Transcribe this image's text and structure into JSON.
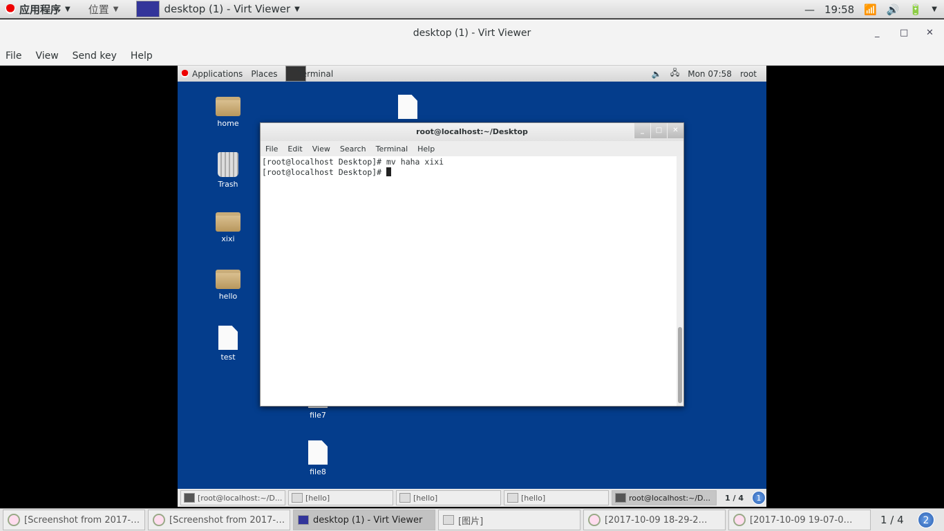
{
  "host_panel": {
    "apps": "应用程序",
    "places": "位置",
    "window": "desktop (1) - Virt Viewer",
    "clock": "19:58",
    "dash": "—"
  },
  "viewer": {
    "title": "desktop (1) - Virt Viewer",
    "menu": [
      "File",
      "View",
      "Send key",
      "Help"
    ]
  },
  "guest_panel": {
    "apps": "Applications",
    "places": "Places",
    "terminal": "Terminal",
    "clock": "Mon 07:58",
    "user": "root"
  },
  "desktop_icons": {
    "home": "home",
    "trash": "Trash",
    "xixi": "xixi",
    "hello": "hello",
    "test": "test",
    "file7": "file7",
    "file8": "file8"
  },
  "terminal": {
    "title": "root@localhost:~/Desktop",
    "menu": [
      "File",
      "Edit",
      "View",
      "Search",
      "Terminal",
      "Help"
    ],
    "lines": [
      "[root@localhost Desktop]# mv haha xixi",
      "[root@localhost Desktop]# "
    ]
  },
  "guest_taskbar": {
    "items": [
      "[root@localhost:~/D...",
      "[hello]",
      "[hello]",
      "[hello]",
      "root@localhost:~/D..."
    ],
    "pager": "1 / 4",
    "badge": "1"
  },
  "host_taskbar": {
    "items": [
      "[Screenshot from 2017-…",
      "[Screenshot from 2017-…",
      "desktop (1) - Virt Viewer",
      "[图片]",
      "[2017-10-09 18-29-2…",
      "[2017-10-09 19-07-0…"
    ],
    "pager": "1 / 4",
    "badge": "2"
  },
  "colors": {
    "guest_desktop": "#043d8c"
  }
}
